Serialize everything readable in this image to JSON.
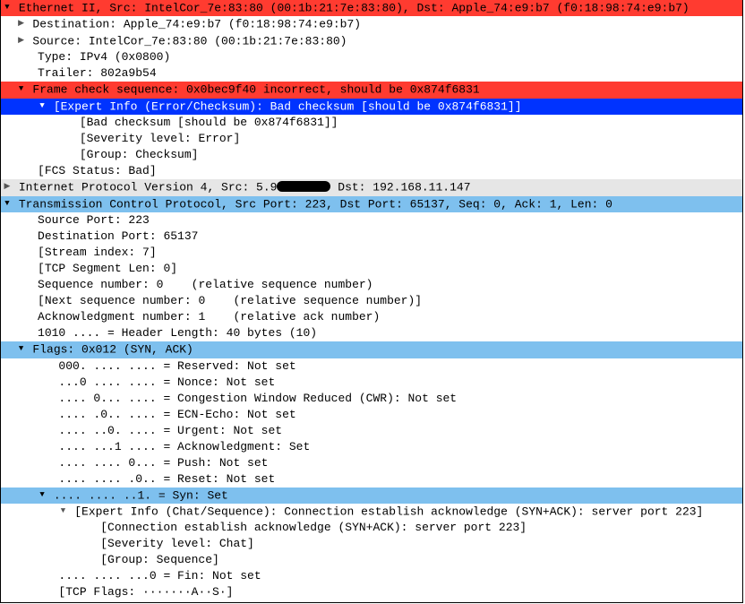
{
  "eth": {
    "header": "Ethernet II, Src: IntelCor_7e:83:80 (00:1b:21:7e:83:80), Dst: Apple_74:e9:b7 (f0:18:98:74:e9:b7)",
    "dst": "Destination: Apple_74:e9:b7 (f0:18:98:74:e9:b7)",
    "src": "Source: IntelCor_7e:83:80 (00:1b:21:7e:83:80)",
    "type": "Type: IPv4 (0x0800)",
    "trailer": "Trailer: 802a9b54",
    "fcs_header": "Frame check sequence: 0x0bec9f40 incorrect, should be 0x874f6831",
    "expert_hdr": "[Expert Info (Error/Checksum): Bad checksum [should be 0x874f6831]]",
    "expert_1": "[Bad checksum [should be 0x874f6831]]",
    "expert_2": "[Severity level: Error]",
    "expert_3": "[Group: Checksum]",
    "fcs_status": "[FCS Status: Bad]"
  },
  "ip": {
    "header_pre": "Internet Protocol Version 4, Src: 5.9",
    "header_post": " Dst: 192.168.11.147"
  },
  "tcp": {
    "header": "Transmission Control Protocol, Src Port: 223, Dst Port: 65137, Seq: 0, Ack: 1, Len: 0",
    "src_port": "Source Port: 223",
    "dst_port": "Destination Port: 65137",
    "stream": "[Stream index: 7]",
    "seg_len": "[TCP Segment Len: 0]",
    "seq": "Sequence number: 0    (relative sequence number)",
    "nseq": "[Next sequence number: 0    (relative sequence number)]",
    "ack": "Acknowledgment number: 1    (relative ack number)",
    "hlen": "1010 .... = Header Length: 40 bytes (10)",
    "flags_header": "Flags: 0x012 (SYN, ACK)",
    "f_res": "000. .... .... = Reserved: Not set",
    "f_nonce": "...0 .... .... = Nonce: Not set",
    "f_cwr": ".... 0... .... = Congestion Window Reduced (CWR): Not set",
    "f_ecn": ".... .0.. .... = ECN-Echo: Not set",
    "f_urg": ".... ..0. .... = Urgent: Not set",
    "f_ack": ".... ...1 .... = Acknowledgment: Set",
    "f_push": ".... .... 0... = Push: Not set",
    "f_reset": ".... .... .0.. = Reset: Not set",
    "f_syn": ".... .... ..1. = Syn: Set",
    "syn_expert_hdr": "[Expert Info (Chat/Sequence): Connection establish acknowledge (SYN+ACK): server port 223]",
    "syn_e1": "[Connection establish acknowledge (SYN+ACK): server port 223]",
    "syn_e2": "[Severity level: Chat]",
    "syn_e3": "[Group: Sequence]",
    "f_fin": ".... .... ...0 = Fin: Not set",
    "tcp_flags_str": "[TCP Flags: ·······A··S·]"
  }
}
